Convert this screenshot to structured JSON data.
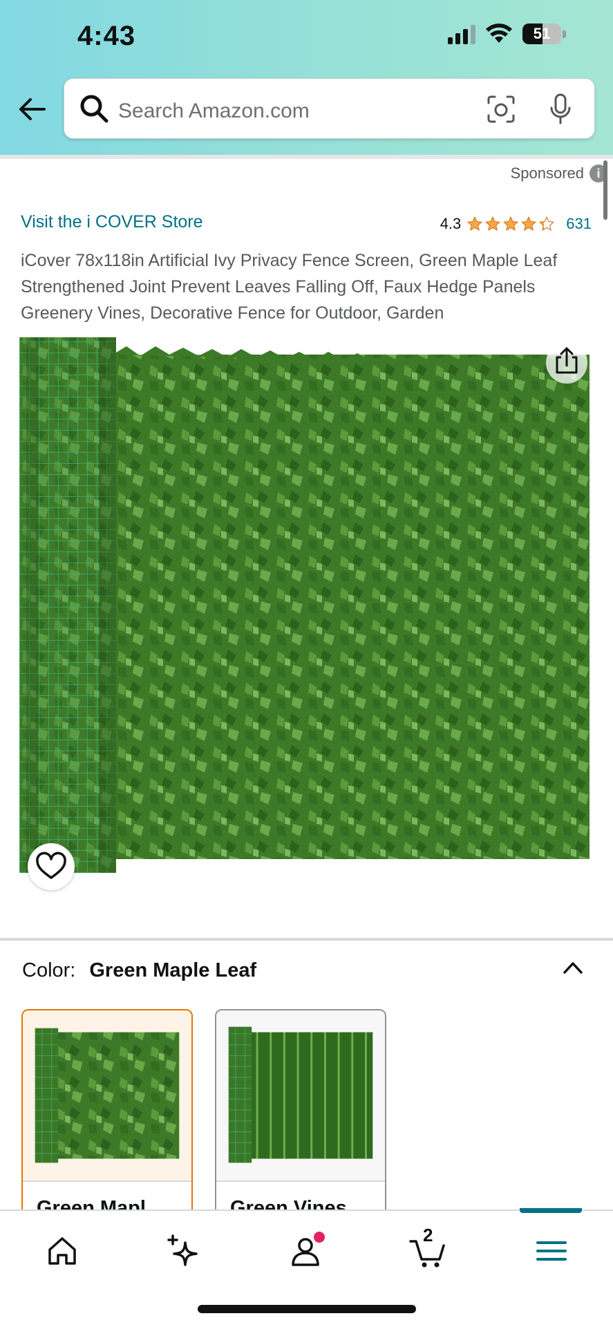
{
  "status_bar": {
    "time": "4:43",
    "battery": "51"
  },
  "search": {
    "placeholder": "Search Amazon.com"
  },
  "sponsored": {
    "label": "Sponsored",
    "info": "i"
  },
  "product": {
    "store_link": "Visit the i COVER Store",
    "rating": "4.3",
    "rating_value": 4.3,
    "review_count": "631",
    "title": "iCover 78x118in Artificial Ivy Privacy Fence Screen, Green Maple Leaf Strengthened Joint Prevent Leaves Falling Off, Faux Hedge Panels Greenery Vines, Decorative Fence for Outdoor, Garden"
  },
  "color_selector": {
    "label": "Color:",
    "selected": "Green Maple Leaf",
    "options": [
      {
        "label": "Green Mapl",
        "selected": true
      },
      {
        "label": "Green Vines",
        "selected": false
      }
    ]
  },
  "bottom_nav": {
    "items": [
      "home-icon",
      "sparkle-icon",
      "account-icon",
      "cart-icon",
      "menu-icon"
    ],
    "cart_count": "2",
    "active": "menu"
  },
  "colors": {
    "link": "#007185",
    "star": "#f3a847",
    "selected_border": "#e77600",
    "leaf_dark": "#2f6b1f",
    "leaf_light": "#5c9a3c"
  }
}
